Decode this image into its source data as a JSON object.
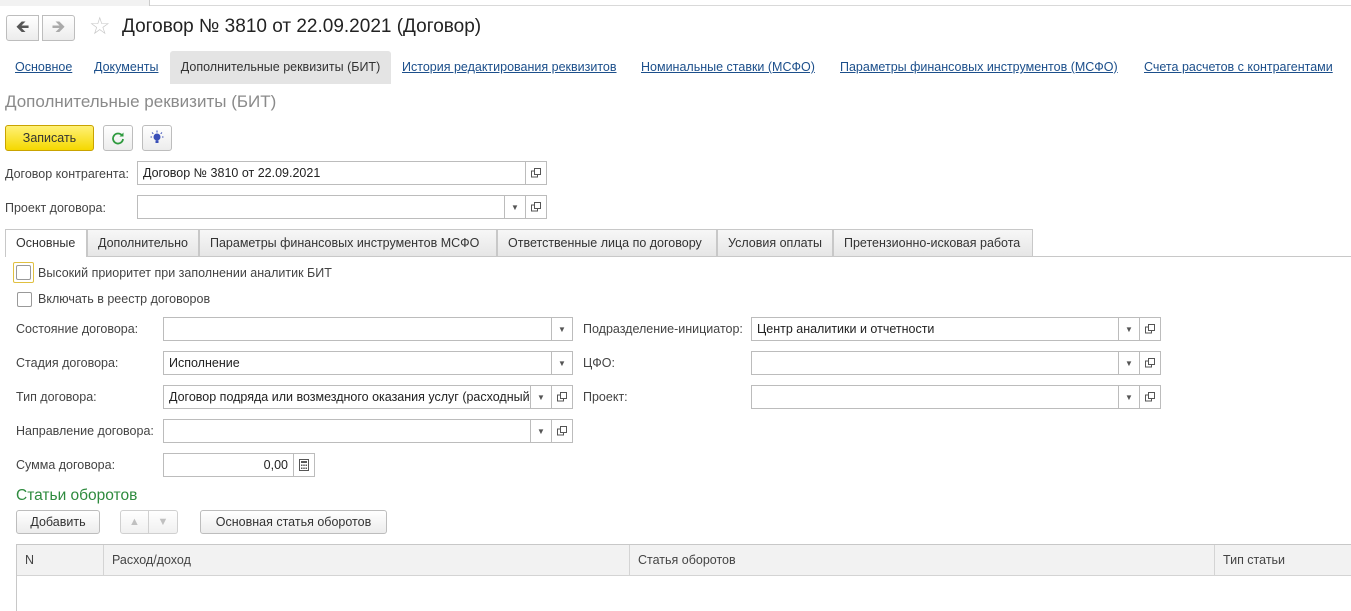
{
  "window": {
    "title": "Договор № 3810 от 22.09.2021 (Договор)"
  },
  "nav": {
    "links": [
      "Основное",
      "Документы",
      "Дополнительные реквизиты (БИТ)",
      "История редактирования реквизитов",
      "Номинальные ставки (МСФО)",
      "Параметры финансовых инструментов (МСФО)",
      "Счета расчетов с контрагентами"
    ],
    "active": "Дополнительные реквизиты (БИТ)"
  },
  "section_title": "Дополнительные реквизиты (БИТ)",
  "toolbar": {
    "save_label": "Записать"
  },
  "form": {
    "contract_label": "Договор контрагента:",
    "contract_value": "Договор № 3810 от 22.09.2021",
    "project_label": "Проект договора:",
    "project_value": ""
  },
  "tabs": [
    "Основные",
    "Дополнительно",
    "Параметры финансовых инструментов МСФО",
    "Ответственные лица по договору",
    "Условия оплаты",
    "Претензионно-исковая работа"
  ],
  "checkboxes": [
    {
      "label": "Высокий приоритет при заполнении аналитик БИТ",
      "checked": false
    },
    {
      "label": "Включать в реестр договоров",
      "checked": false
    }
  ],
  "left_fields": {
    "state_label": "Состояние договора:",
    "state_value": "",
    "stage_label": "Стадия договора:",
    "stage_value": "Исполнение",
    "type_label": "Тип договора:",
    "type_value": "Договор подряда или возмездного оказания услуг (расходный)",
    "direction_label": "Направление договора:",
    "direction_value": "",
    "sum_label": "Сумма договора:",
    "sum_value": "0,00"
  },
  "right_fields": {
    "dept_label": "Подразделение-инициатор:",
    "dept_value": "Центр аналитики и отчетности",
    "cfo_label": "ЦФО:",
    "cfo_value": "",
    "project_label": "Проект:",
    "project_value": ""
  },
  "turnover": {
    "title": "Статьи оборотов",
    "add_label": "Добавить",
    "main_label": "Основная статья оборотов",
    "columns": [
      "N",
      "Расход/доход",
      "Статья оборотов",
      "Тип статьи"
    ]
  },
  "colors": {
    "accent_yellow": "#f5d800",
    "link_blue": "#1c4f8b",
    "section_green": "#2e8b3e"
  }
}
